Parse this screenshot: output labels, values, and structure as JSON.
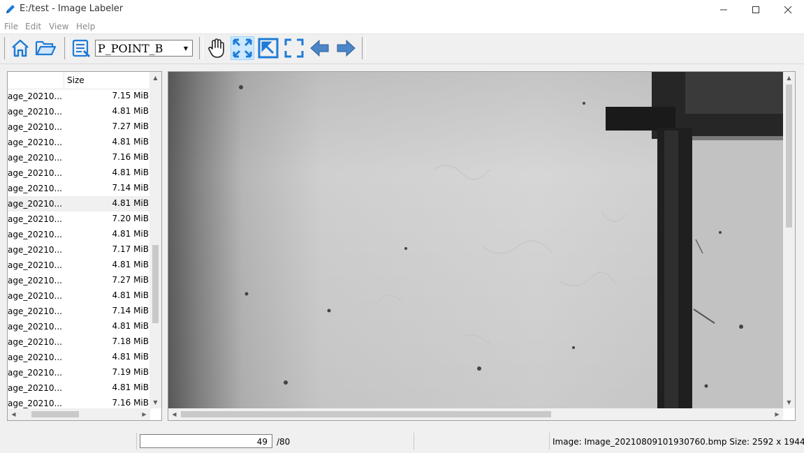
{
  "window": {
    "title": "E:/test - Image Labeler"
  },
  "menu": [
    "File",
    "Edit",
    "View",
    "Help"
  ],
  "toolbar": {
    "label_selector": {
      "selected": "P_POINT_B"
    },
    "icons": [
      "home-icon",
      "folder-open-icon",
      "label-list-icon",
      "hand-pan-icon",
      "fit-to-window-icon",
      "actual-size-icon",
      "fit-frame-icon",
      "previous-arrow-icon",
      "next-arrow-icon"
    ]
  },
  "file_list": {
    "size_header": "Size",
    "rows": [
      {
        "name": "age_20210...",
        "size": "7.15 MiB"
      },
      {
        "name": "age_20210...",
        "size": "4.81 MiB"
      },
      {
        "name": "age_20210...",
        "size": "7.27 MiB"
      },
      {
        "name": "age_20210...",
        "size": "4.81 MiB"
      },
      {
        "name": "age_20210...",
        "size": "7.16 MiB"
      },
      {
        "name": "age_20210...",
        "size": "4.81 MiB"
      },
      {
        "name": "age_20210...",
        "size": "7.14 MiB"
      },
      {
        "name": "age_20210...",
        "size": "4.81 MiB",
        "selected": true
      },
      {
        "name": "age_20210...",
        "size": "7.20 MiB"
      },
      {
        "name": "age_20210...",
        "size": "4.81 MiB"
      },
      {
        "name": "age_20210...",
        "size": "7.17 MiB"
      },
      {
        "name": "age_20210...",
        "size": "4.81 MiB"
      },
      {
        "name": "age_20210...",
        "size": "7.27 MiB"
      },
      {
        "name": "age_20210...",
        "size": "4.81 MiB"
      },
      {
        "name": "age_20210...",
        "size": "7.14 MiB"
      },
      {
        "name": "age_20210...",
        "size": "4.81 MiB"
      },
      {
        "name": "age_20210...",
        "size": "7.18 MiB"
      },
      {
        "name": "age_20210...",
        "size": "4.81 MiB"
      },
      {
        "name": "age_20210...",
        "size": "7.19 MiB"
      },
      {
        "name": "age_20210...",
        "size": "4.81 MiB"
      },
      {
        "name": "age_20210...",
        "size": "7.16 MiB"
      }
    ]
  },
  "status": {
    "current_index": "49",
    "total": "/80",
    "image_info": "Image: Image_20210809101930760.bmp Size: 2592 x 1944"
  },
  "colors": {
    "accent": "#1e7bd8",
    "selection": "#cce8ff",
    "selected_row": "#f0f0f0"
  }
}
